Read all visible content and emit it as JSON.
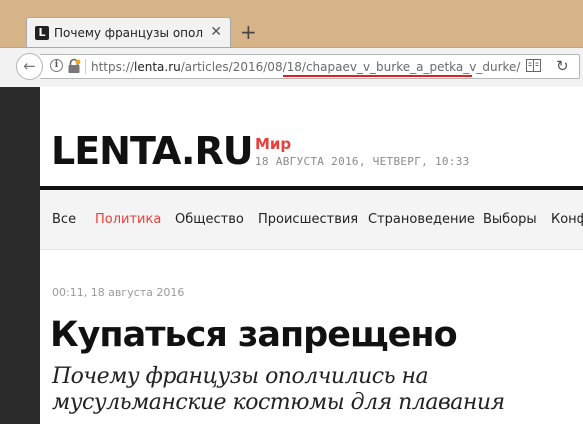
{
  "browser": {
    "tab": {
      "favicon": "L",
      "title": "Почему французы опол...",
      "close": "✕"
    },
    "new_tab": "+",
    "url": {
      "scheme": "https://",
      "domain": "lenta.ru",
      "path": "/articles/2016/08/18/",
      "slug": "chapaev_v_burke_a_petka_v_durke/"
    },
    "icons": {
      "back": "back-arrow-icon",
      "info": "info-icon",
      "lock": "lock-icon",
      "reader": "reader-view-icon",
      "refresh": "refresh-icon"
    },
    "highlight_color": "#e02020"
  },
  "site": {
    "logo": "LENTA.RU",
    "rubric": "Мир",
    "date_line": "18 АВГУСТА 2016, ЧЕТВЕРГ, 10:33",
    "accent_color": "#e8403d"
  },
  "nav": {
    "items": [
      {
        "label": "Все",
        "active": false
      },
      {
        "label": "Политика",
        "active": true
      },
      {
        "label": "Общество",
        "active": false
      },
      {
        "label": "Происшествия",
        "active": false
      },
      {
        "label": "Страноведение",
        "active": false
      },
      {
        "label": "Выборы",
        "active": false
      },
      {
        "label": "Конф",
        "active": false
      }
    ]
  },
  "article": {
    "published": "00:11, 18 августа 2016",
    "title": "Купаться запрещено",
    "subtitle": "Почему французы ополчились на мусульманские костюмы для плавания"
  }
}
